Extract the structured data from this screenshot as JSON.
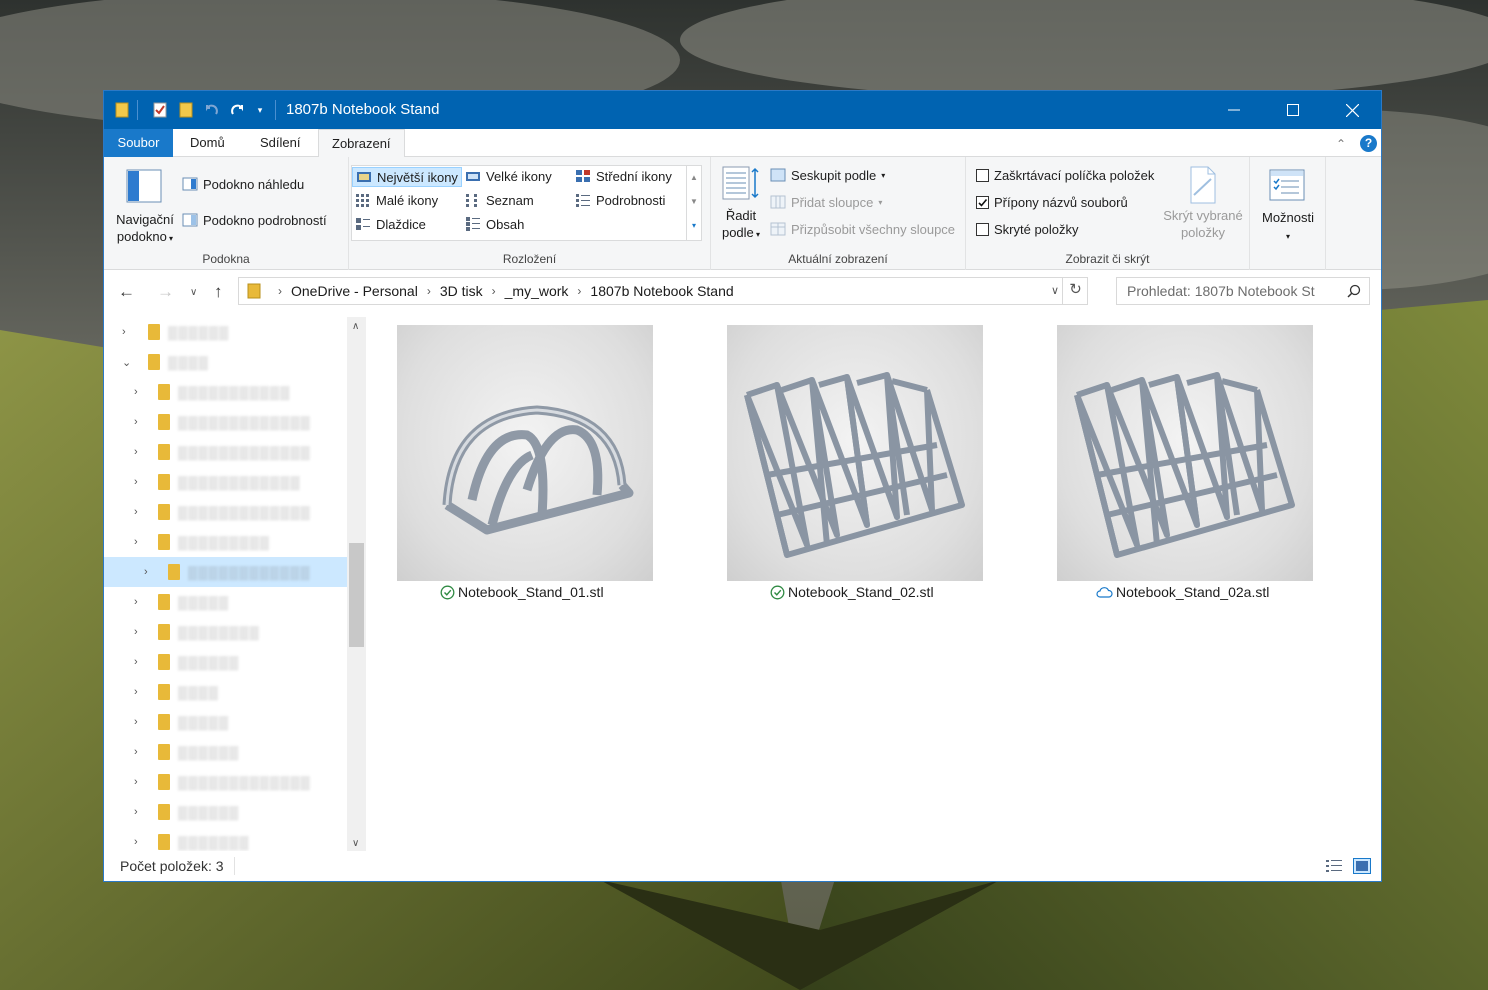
{
  "window": {
    "title": "1807b Notebook Stand"
  },
  "tabs": [
    {
      "label": "Soubor"
    },
    {
      "label": "Domů"
    },
    {
      "label": "Sdílení"
    },
    {
      "label": "Zobrazení"
    }
  ],
  "ribbon": {
    "panes": {
      "nav_pane_line1": "Navigační",
      "nav_pane_line2": "podokno",
      "preview_pane": "Podokno náhledu",
      "details_pane": "Podokno podrobností",
      "label": "Podokna"
    },
    "layout": {
      "extra_large": "Největší ikony",
      "large": "Velké ikony",
      "medium": "Střední ikony",
      "small": "Malé ikony",
      "list": "Seznam",
      "details": "Podrobnosti",
      "tiles": "Dlaždice",
      "content": "Obsah",
      "label": "Rozložení"
    },
    "current_view": {
      "sort_line1": "Řadit",
      "sort_line2": "podle",
      "group_by": "Seskupit podle",
      "add_columns": "Přidat sloupce",
      "fit_columns": "Přizpůsobit všechny sloupce",
      "label": "Aktuální zobrazení"
    },
    "show_hide": {
      "item_checkboxes": "Zaškrtávací políčka položek",
      "file_extensions": "Přípony názvů souborů",
      "hidden_items": "Skryté položky",
      "hide_selected_line1": "Skrýt vybrané",
      "hide_selected_line2": "položky",
      "label": "Zobrazit či skrýt"
    },
    "options": {
      "label": "Možnosti"
    }
  },
  "address": {
    "crumbs": [
      "OneDrive - Personal",
      "3D tisk",
      "_my_work",
      "1807b Notebook Stand"
    ],
    "search_placeholder": "Prohledat: 1807b Notebook St"
  },
  "files": [
    {
      "name": "Notebook_Stand_01.stl",
      "sync": "synced"
    },
    {
      "name": "Notebook_Stand_02.stl",
      "sync": "synced"
    },
    {
      "name": "Notebook_Stand_02a.stl",
      "sync": "cloud"
    }
  ],
  "status": {
    "item_count": "Počet položek: 3"
  },
  "colors": {
    "titlebar": "#0063b1",
    "file_tab": "#1979ca",
    "selection": "#cce8ff",
    "folder": "#e8b939"
  }
}
